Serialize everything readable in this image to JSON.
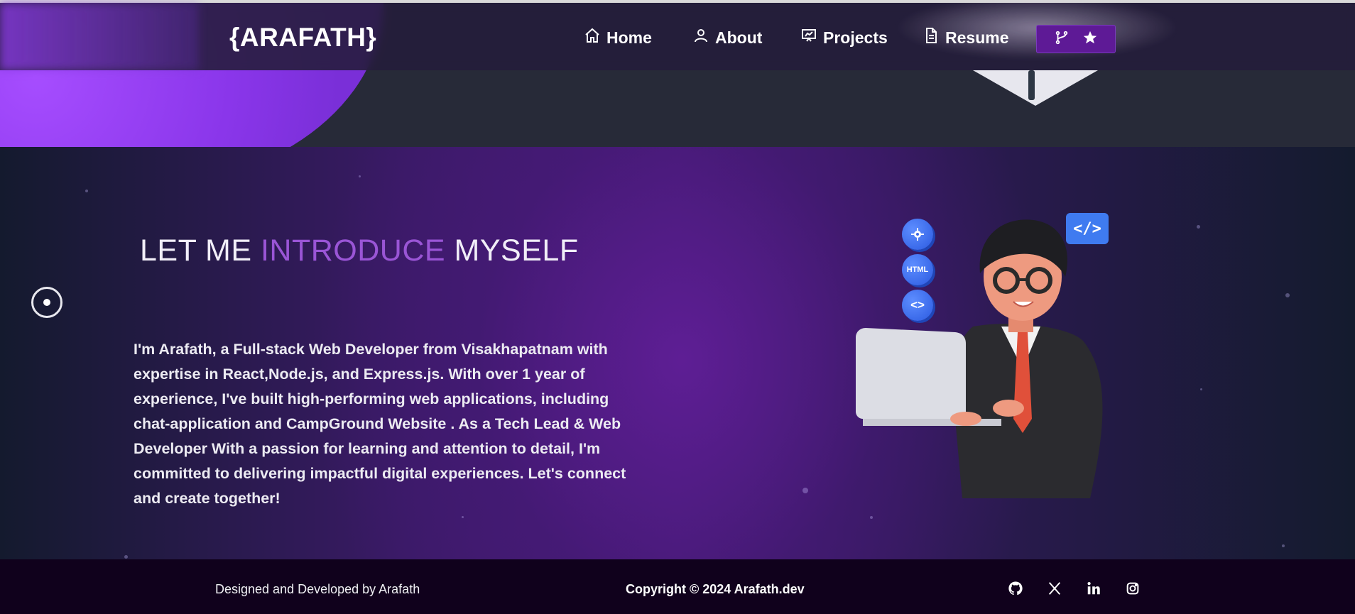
{
  "brand": {
    "logo": "{ARAFATH}"
  },
  "nav": {
    "items": [
      {
        "label": "Home",
        "icon": "home-icon"
      },
      {
        "label": "About",
        "icon": "user-icon"
      },
      {
        "label": "Projects",
        "icon": "presentation-icon"
      },
      {
        "label": "Resume",
        "icon": "document-icon"
      }
    ],
    "github_button": {
      "icons": [
        "fork-icon",
        "star-icon"
      ],
      "color": "#5e1a96"
    }
  },
  "about": {
    "title_prefix": "LET ME ",
    "title_highlight": "INTRODUCE",
    "title_suffix": " MYSELF",
    "highlight_color": "#9a55d6",
    "paragraph": "I'm Arafath, a Full-stack Web Developer from Visakhapatnam with expertise in React,Node.js, and Express.js. With over 1 year of experience, I've built high-performing web applications, including chat-application and CampGround Website . As a Tech Lead & Web Developer With a passion for learning and attention to detail, I'm committed to delivering impactful digital experiences. Let's connect and create together!"
  },
  "illustration": {
    "chips": [
      "gear-icon",
      "HTML",
      "<>"
    ],
    "bubble": "</>"
  },
  "footer": {
    "left": "Designed and Developed by Arafath",
    "center": "Copyright © 2024 Arafath.dev",
    "social": [
      "github-icon",
      "x-icon",
      "linkedin-icon",
      "instagram-icon"
    ]
  }
}
